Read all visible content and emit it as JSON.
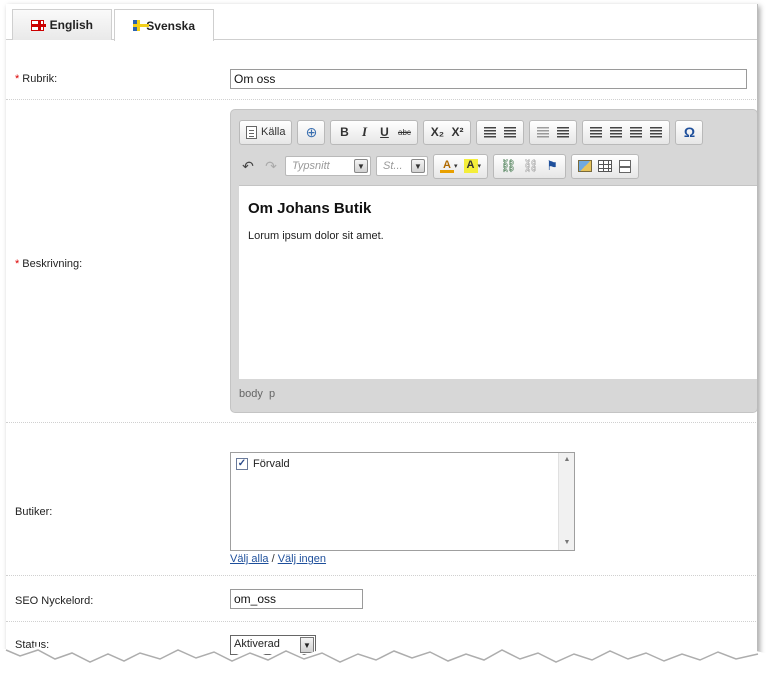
{
  "tabs": [
    {
      "label": "English",
      "flag": "uk-flag-icon",
      "active": false
    },
    {
      "label": "Svenska",
      "flag": "sweden-flag-icon",
      "active": true
    }
  ],
  "fields": {
    "title": {
      "label": "Rubrik:",
      "required": true,
      "value": "Om oss"
    },
    "description": {
      "label": "Beskrivning:",
      "required": true
    },
    "stores": {
      "label": "Butiker:"
    },
    "seo": {
      "label": "SEO Nyckelord:",
      "value": "om_oss"
    },
    "status": {
      "label": "Status:",
      "value": "Aktiverad"
    }
  },
  "editor": {
    "source_label": "Källa",
    "font_placeholder": "Typsnitt",
    "style_placeholder": "St...",
    "heading": "Om Johans Butik",
    "paragraph": "Lorum ipsum dolor sit amet.",
    "path": "body  p",
    "bold": "B",
    "italic": "I",
    "underline": "U",
    "strike": "abc",
    "subscript": "X₂",
    "superscript": "X²",
    "special_char": "Ω"
  },
  "stores_list": {
    "items": [
      {
        "label": "Förvald",
        "checked": true
      }
    ],
    "select_all": "Välj alla",
    "separator": " / ",
    "select_none": "Välj ingen"
  },
  "required_marker": "*",
  "colors": {
    "required": "#dd0000",
    "link": "#1e4f9b",
    "toolbar_bg": "#d7d7d7"
  }
}
